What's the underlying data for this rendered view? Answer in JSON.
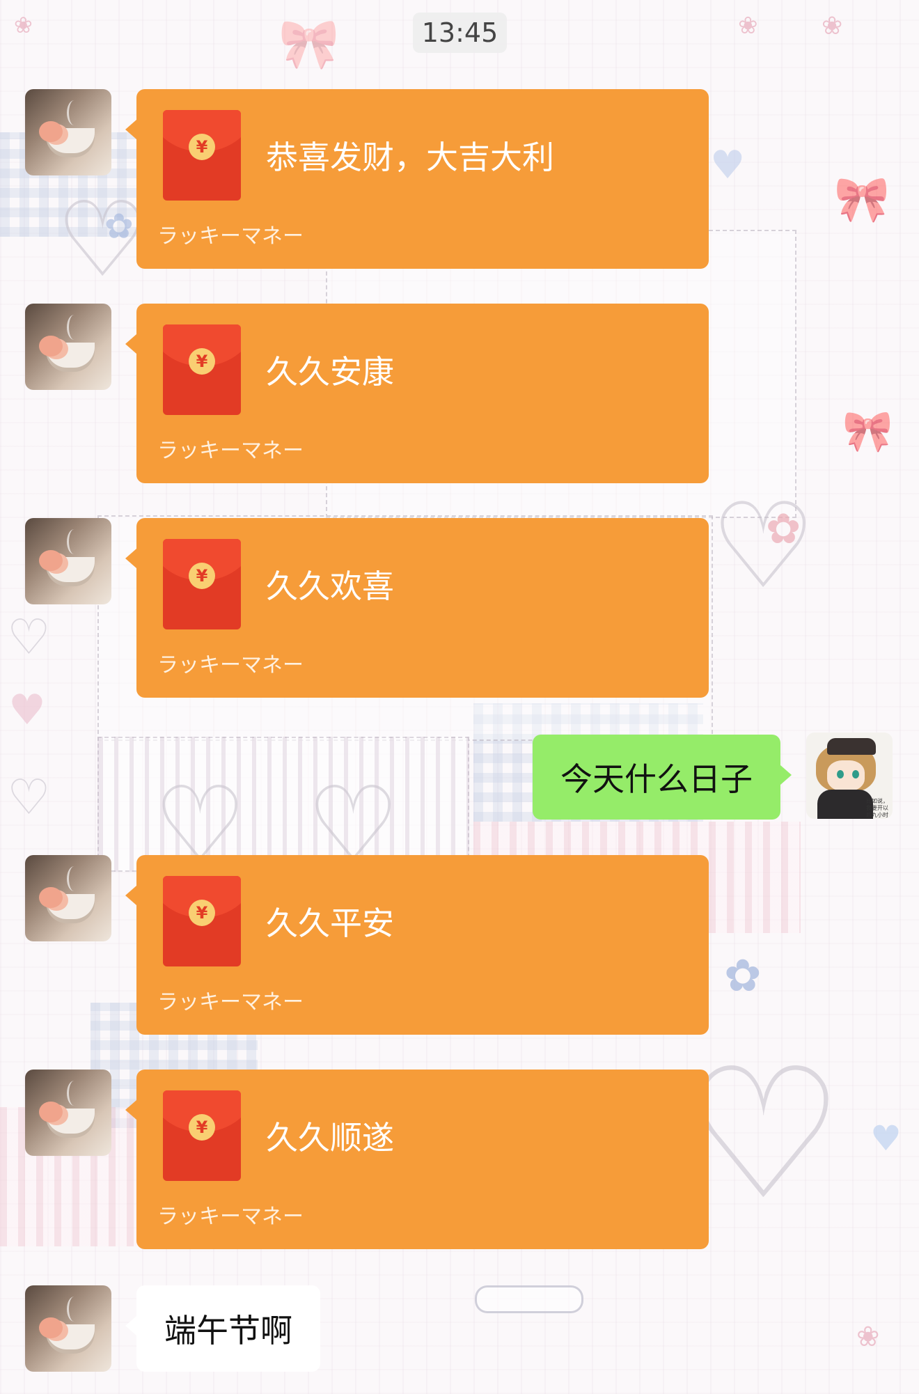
{
  "status": {
    "time": "13:45"
  },
  "chat": {
    "packets": [
      {
        "title": "恭喜发财，大吉大利",
        "subtitle": "ラッキーマネー",
        "icon": "red-packet-icon"
      },
      {
        "title": "久久安康",
        "subtitle": "ラッキーマネー",
        "icon": "red-packet-icon"
      },
      {
        "title": "久久欢喜",
        "subtitle": "ラッキーマネー",
        "icon": "red-packet-icon"
      },
      {
        "title": "久久平安",
        "subtitle": "ラッキーマネー",
        "icon": "red-packet-icon"
      },
      {
        "title": "久久顺遂",
        "subtitle": "ラッキーマネー",
        "icon": "red-packet-icon"
      }
    ],
    "my_message": "今天什么日子",
    "their_message": "端午节啊",
    "coin_symbol": "¥",
    "my_avatar_note": "比如说，我要开以后九小时工作"
  },
  "colors": {
    "packet_bubble": "#f69c39",
    "packet_red": "#e23b25",
    "my_bubble": "#95ec69",
    "their_bubble": "#ffffff"
  }
}
